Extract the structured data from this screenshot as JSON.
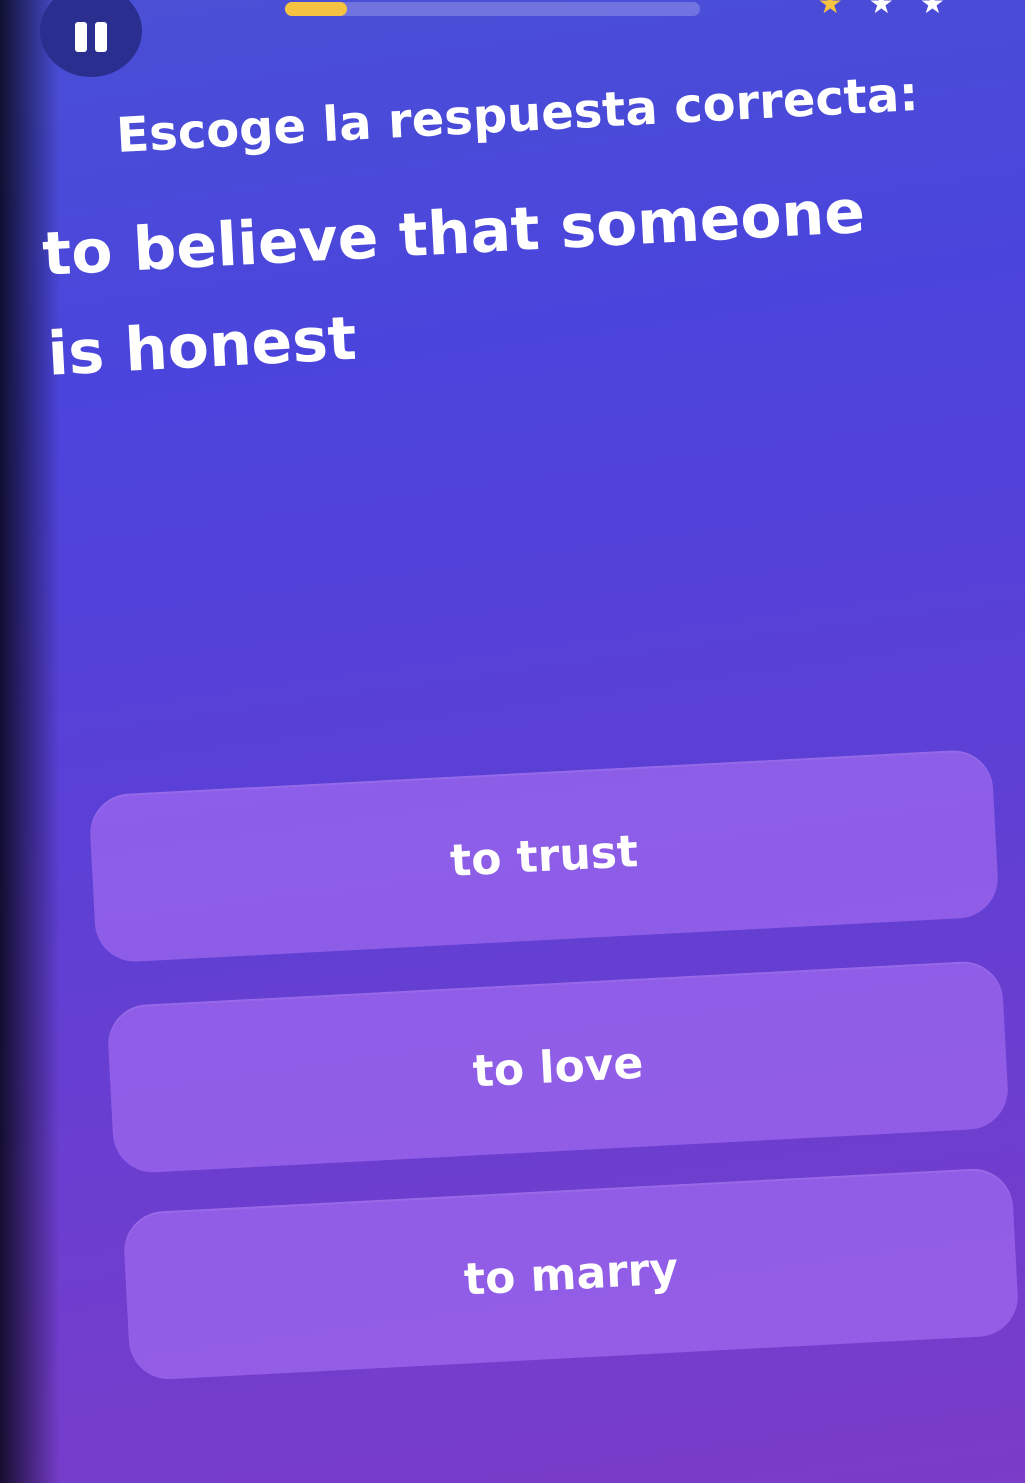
{
  "header": {
    "pause_icon": "pause-icon",
    "progress": 0.15,
    "progress_color": "#f5c242",
    "stars": [
      {
        "icon": "star-icon",
        "color": "#f5c242"
      },
      {
        "icon": "star-icon",
        "color": "#ffffff"
      },
      {
        "icon": "star-icon",
        "color": "#ffffff"
      }
    ]
  },
  "quiz": {
    "instruction": "Escoge la respuesta correcta:",
    "question": "to believe that someone is honest",
    "options": [
      {
        "label": "to trust"
      },
      {
        "label": "to love"
      },
      {
        "label": "to marry"
      }
    ]
  },
  "colors": {
    "background_top": "#4a50d6",
    "background_bottom": "#7b3cc8",
    "option_fill": "#a069f0"
  }
}
